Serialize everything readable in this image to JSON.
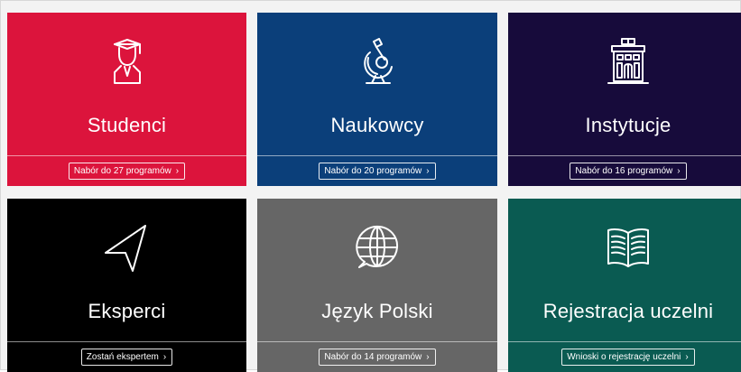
{
  "tiles": [
    {
      "title": "Studenci",
      "button": "Nabór do 27 programów",
      "chevron": "›",
      "icon": "graduate-icon",
      "color": "#dc143c"
    },
    {
      "title": "Naukowcy",
      "button": "Nabór do 20 programów",
      "chevron": "›",
      "icon": "microscope-icon",
      "color": "#0b3f7a"
    },
    {
      "title": "Instytucje",
      "button": "Nabór do 16 programów",
      "chevron": "›",
      "icon": "building-icon",
      "color": "#170b3b"
    },
    {
      "title": "Eksperci",
      "button": "Zostań ekspertem",
      "chevron": "›",
      "icon": "paper-plane-icon",
      "color": "#000000"
    },
    {
      "title": "Język Polski",
      "button": "Nabór do 14 programów",
      "chevron": "›",
      "icon": "globe-chat-icon",
      "color": "#666666"
    },
    {
      "title": "Rejestracja uczelni",
      "button": "Wnioski o rejestrację uczelni",
      "chevron": "›",
      "icon": "open-book-icon",
      "color": "#0a5b52"
    }
  ]
}
